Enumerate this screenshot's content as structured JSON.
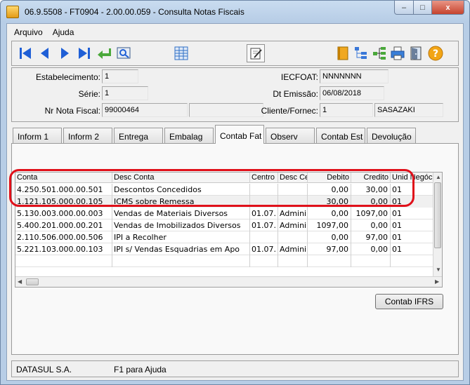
{
  "window": {
    "title": "06.9.5508 - FT0904 - 2.00.00.059 - Consulta Notas Fiscais",
    "controls": {
      "minimize": "–",
      "maximize": "□",
      "close": "x"
    }
  },
  "menu": [
    "Arquivo",
    "Ajuda"
  ],
  "toolbar": {
    "icons": [
      "first-icon",
      "previous-icon",
      "next-icon",
      "last-icon",
      "goto-icon",
      "search-icon",
      "calendar-grid-icon",
      "edit-icon",
      "book-icon",
      "tree-icon",
      "hierarchy-icon",
      "printer-icon",
      "exit-door-icon",
      "help-icon"
    ]
  },
  "header": {
    "estabelecimento_label": "Estabelecimento:",
    "estabelecimento_value": "1",
    "serie_label": "Série:",
    "serie_value": "1",
    "nr_nota_label": "Nr Nota Fiscal:",
    "nr_nota_value": "99000464",
    "iecfoat_label": "IECFOAT:",
    "iecfoat_value": "NNNNNNN",
    "dt_emissao_label": "Dt Emissão:",
    "dt_emissao_value": "06/08/2018",
    "cliente_label": "Cliente/Fornec:",
    "cliente_code": "1",
    "cliente_name": "SASAZAKI"
  },
  "tabs": [
    {
      "label": "Inform 1",
      "active": false
    },
    {
      "label": "Inform 2",
      "active": false
    },
    {
      "label": "Entrega",
      "active": false
    },
    {
      "label": "Embalag",
      "active": false
    },
    {
      "label": "Contab Fat",
      "active": true
    },
    {
      "label": "Observ",
      "active": false
    },
    {
      "label": "Contab Est",
      "active": false
    },
    {
      "label": "Devolução",
      "active": false
    }
  ],
  "grid": {
    "columns": [
      "Conta",
      "Desc Conta",
      "Centro",
      "Desc Ce",
      "Debito",
      "Credito",
      "Unid Negóc"
    ],
    "rows": [
      [
        "4.250.501.000.00.501",
        "Descontos Concedidos",
        "",
        "",
        "0,00",
        "30,00",
        "01"
      ],
      [
        "1.121.105.000.00.105",
        "ICMS sobre Remessa",
        "",
        "",
        "30,00",
        "0,00",
        "01"
      ],
      [
        "5.130.003.000.00.003",
        "Vendas de Materiais Diversos",
        "01.07.",
        "Admini",
        "0,00",
        "1097,00",
        "01"
      ],
      [
        "5.400.201.000.00.201",
        "Vendas de Imobilizados Diversos",
        "01.07.",
        "Admini",
        "1097,00",
        "0,00",
        "01"
      ],
      [
        "2.110.506.000.00.506",
        "IPI a Recolher",
        "",
        "",
        "0,00",
        "97,00",
        "01"
      ],
      [
        "5.221.103.000.00.103",
        "IPI s/ Vendas Esquadrias em Apo",
        "01.07.",
        "Admini",
        "97,00",
        "0,00",
        "01"
      ]
    ]
  },
  "buttons": {
    "contab_ifrs": "Contab IFRS"
  },
  "status": {
    "company": "DATASUL S.A.",
    "help": "F1 para Ajuda"
  },
  "colors": {
    "annotation": "#e0101a",
    "nav_blue": "#1f5fd6",
    "titlebar": "#c9dcf0"
  }
}
